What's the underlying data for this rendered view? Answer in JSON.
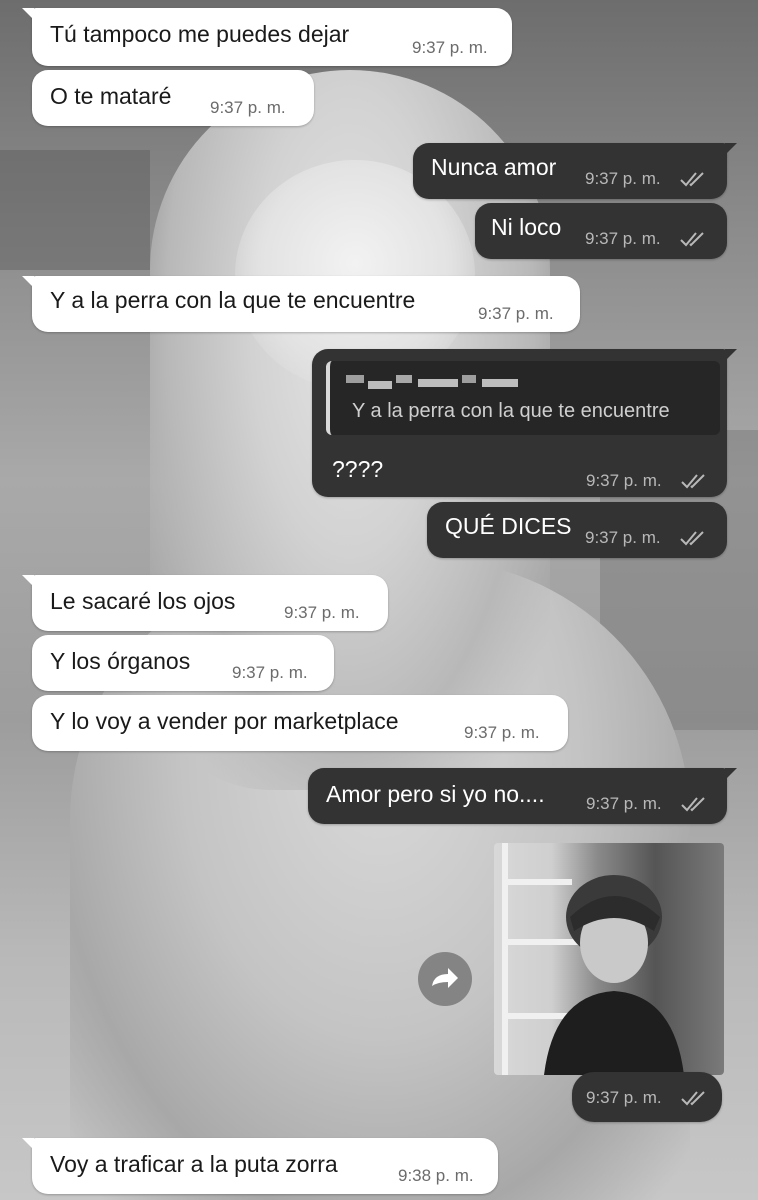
{
  "chat": {
    "messages": [
      {
        "side": "in",
        "text": "Tú tampoco me puedes dejar",
        "time": "9:37 p. m."
      },
      {
        "side": "in",
        "text": "O te mataré",
        "time": "9:37 p. m."
      },
      {
        "side": "out",
        "text": "Nunca amor",
        "time": "9:37 p. m.",
        "status": "read"
      },
      {
        "side": "out",
        "text": "Ni loco",
        "time": "9:37 p. m.",
        "status": "read"
      },
      {
        "side": "in",
        "text": "Y a la perra con la que te encuentre",
        "time": "9:37 p. m."
      },
      {
        "side": "out",
        "text": "????",
        "time": "9:37 p. m.",
        "status": "read",
        "reply_to": {
          "text": "Y a la perra con la que te encuentre",
          "sender_redacted": true
        }
      },
      {
        "side": "out",
        "text": "QUÉ DICES",
        "time": "9:37 p. m.",
        "status": "read"
      },
      {
        "side": "in",
        "text": "Le sacaré los ojos",
        "time": "9:37 p. m."
      },
      {
        "side": "in",
        "text": "Y los órganos",
        "time": "9:37 p. m."
      },
      {
        "side": "in",
        "text": "Y lo voy a vender por marketplace",
        "time": "9:37 p. m."
      },
      {
        "side": "out",
        "text": "Amor pero si yo no....",
        "time": "9:37 p. m.",
        "status": "read"
      },
      {
        "side": "out",
        "type": "image",
        "time": "9:37 p. m.",
        "status": "read"
      },
      {
        "side": "in",
        "text": "Voy a traficar a la puta zorra",
        "time": "9:38 p. m."
      }
    ]
  },
  "icons": {
    "read_receipt": "double-check-icon",
    "forward": "forward-icon"
  },
  "colors": {
    "incoming_bubble": "#ffffff",
    "outgoing_bubble": "#333333"
  }
}
